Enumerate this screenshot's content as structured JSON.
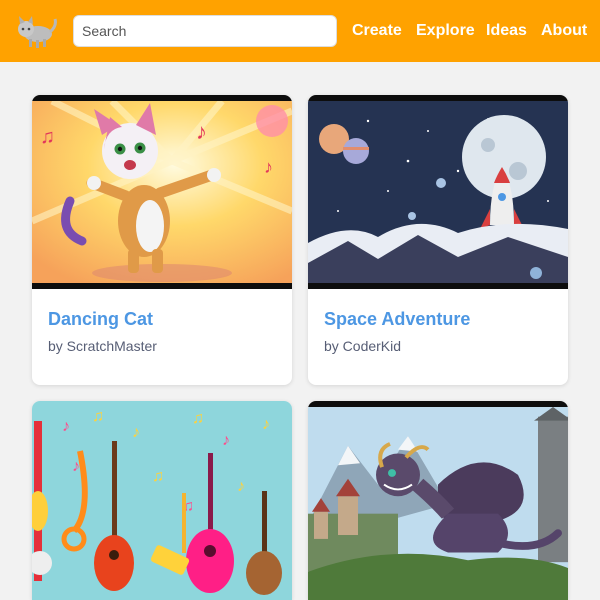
{
  "header": {
    "logo_icon": "scratch-cat-logo-icon",
    "search": {
      "placeholder": "Search",
      "value": ""
    },
    "nav": [
      "Create",
      "Explore",
      "Ideas",
      "About"
    ],
    "background_color": "#ffa200"
  },
  "projects": [
    {
      "title": "Dancing Cat",
      "author": "by ScratchMaster",
      "thumbnail_icon": "dancing-cat-thumbnail"
    },
    {
      "title": "Space Adventure",
      "author": "by CoderKid",
      "thumbnail_icon": "space-rocket-thumbnail"
    },
    {
      "thumbnail_icon": "music-instruments-thumbnail"
    },
    {
      "thumbnail_icon": "dragon-castle-thumbnail"
    }
  ],
  "colors": {
    "title_link": "#4d97e3",
    "author_text": "#575e75"
  }
}
